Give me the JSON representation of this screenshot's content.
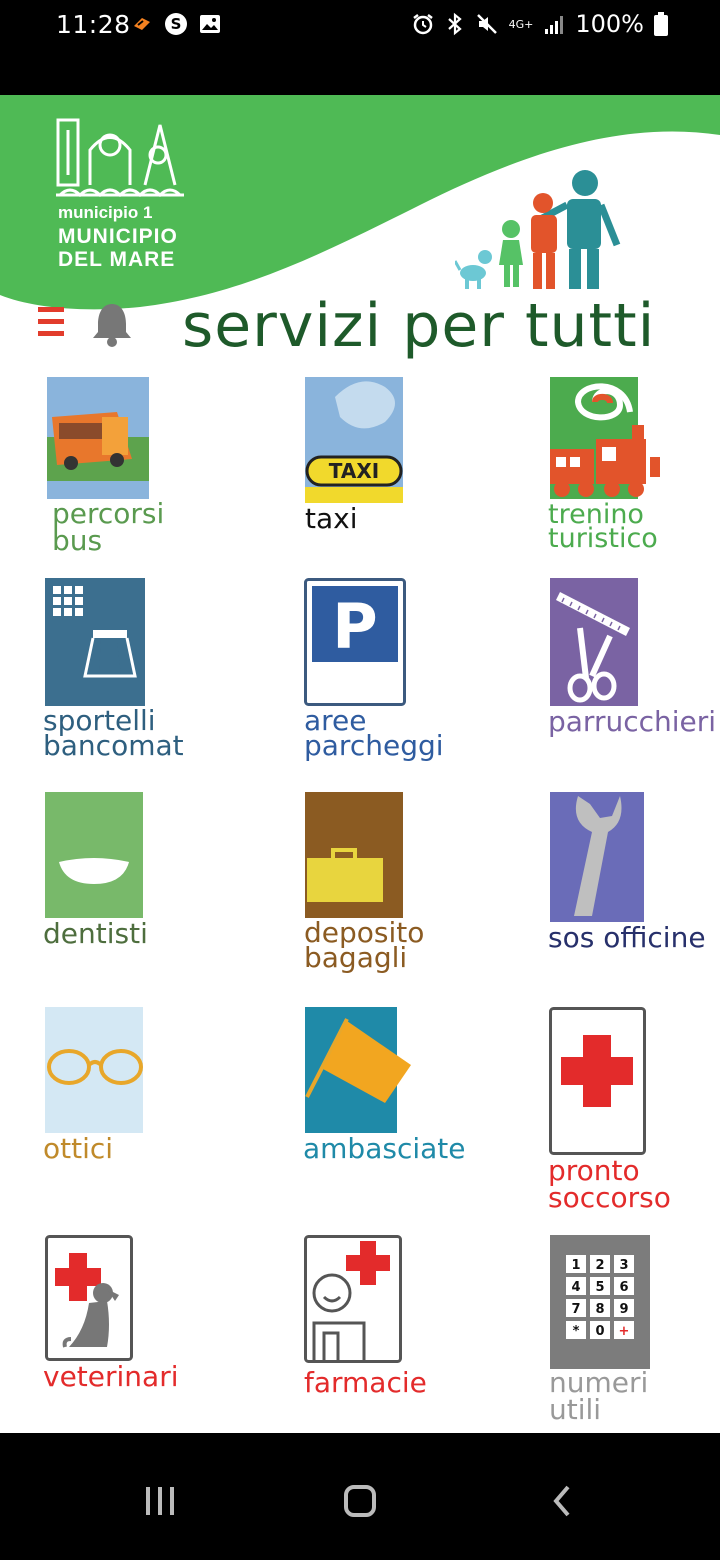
{
  "status_bar": {
    "time": "11:28",
    "battery": "100%",
    "network": "4G+"
  },
  "header": {
    "logo_small": "municipio 1",
    "logo_big_line1": "MUNICIPIO",
    "logo_big_line2": "DEL MARE",
    "title": "servizi per tutti",
    "header_color": "#4fba55"
  },
  "services": [
    {
      "label": "percorsi\nbus",
      "color": "#5a9a4f"
    },
    {
      "label": "taxi",
      "color": "#111111"
    },
    {
      "label": "trenino\nturistico",
      "color": "#4cab4e"
    },
    {
      "label": "sportelli\nbancomat",
      "color": "#2e5f7f"
    },
    {
      "label": "aree\nparcheggi",
      "color": "#2f5ca0"
    },
    {
      "label": "parrucchieri",
      "color": "#7a63a3"
    },
    {
      "label": "dentisti",
      "color": "#4e6e3e"
    },
    {
      "label": "deposito\nbagagli",
      "color": "#8b5b22"
    },
    {
      "label": "sos officine",
      "color": "#27306b"
    },
    {
      "label": "ottici",
      "color": "#c08a2a"
    },
    {
      "label": "ambasciate",
      "color": "#1f8aa8"
    },
    {
      "label": "pronto\nsoccorso",
      "color": "#e32b2b"
    },
    {
      "label": "veterinari",
      "color": "#e32b2b"
    },
    {
      "label": "farmacie",
      "color": "#e32b2b"
    },
    {
      "label": "numeri\nutili",
      "color": "#888888"
    }
  ],
  "keypad": [
    "1",
    "2",
    "3",
    "4",
    "5",
    "6",
    "7",
    "8",
    "9",
    "*",
    "0",
    "+"
  ],
  "taxi_sign": "TAXI",
  "parking_sign": "P"
}
